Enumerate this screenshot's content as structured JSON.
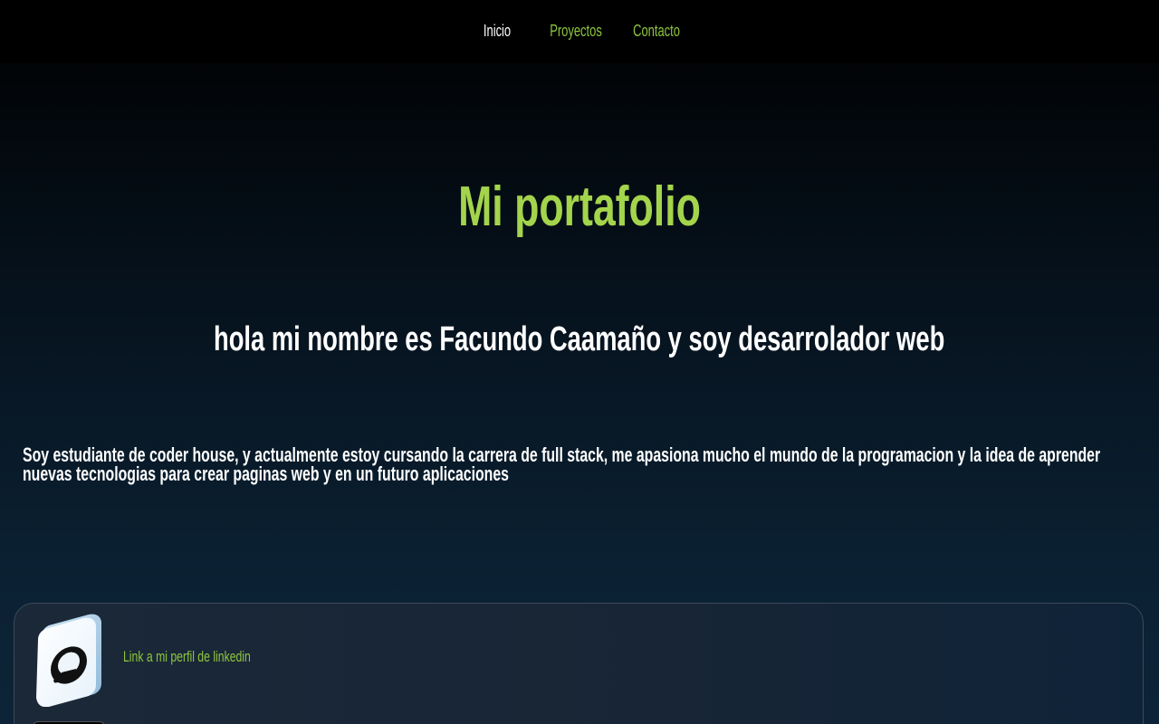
{
  "nav": {
    "items": [
      {
        "label": "Inicio",
        "active": true
      },
      {
        "label": "Proyectos",
        "active": false
      },
      {
        "label": "Contacto",
        "active": false
      }
    ]
  },
  "hero": {
    "title": "Mi portafolio",
    "subtitle": "hola mi nombre es Facundo Caamaño y soy desarrolador web"
  },
  "about": {
    "text": "Soy estudiante de coder house, y actualmente estoy cursando la carrera de full stack, me apasiona mucho el mundo de la programacion y la idea de aprender nuevas tecnologias para crear paginas web y en un futuro aplicaciones"
  },
  "links": {
    "linkedin_label": "Link a mi perfil de linkedin",
    "github_icon": "github-icon"
  },
  "colors": {
    "accent": "#8ec63f",
    "title": "#a4d44c",
    "background": "#0b2133"
  }
}
